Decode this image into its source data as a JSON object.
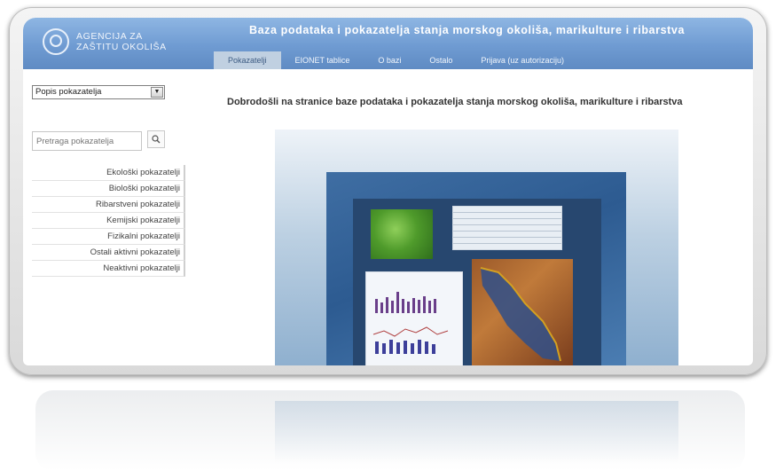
{
  "header": {
    "logo_line1": "AGENCIJA ZA",
    "logo_line2": "ZAŠTITU OKOLIŠA",
    "site_title": "Baza podataka i pokazatelja stanja morskog okoliša, marikulture i ribarstva"
  },
  "nav": {
    "items": [
      {
        "label": "Pokazatelji",
        "active": true
      },
      {
        "label": "EIONET tablice"
      },
      {
        "label": "O bazi"
      },
      {
        "label": "Ostalo"
      },
      {
        "label": "Prijava (uz autorizaciju)"
      }
    ]
  },
  "sidebar": {
    "select_value": "Popis pokazatelja",
    "search_placeholder": "Pretraga pokazatelja",
    "indicators": [
      "Ekološki pokazatelji",
      "Biološki pokazatelji",
      "Ribarstveni pokazatelji",
      "Kemijski pokazatelji",
      "Fizikalni pokazatelji",
      "Ostali aktivni pokazatelji",
      "Neaktivni pokazatelji"
    ]
  },
  "main": {
    "welcome_text": "Dobrodošli na stranice baze podataka i pokazatelja stanja morskog okoliša, marikulture i ribarstva"
  },
  "colors": {
    "header_blue": "#6f9bd2",
    "nav_active": "#c0d0e1"
  }
}
